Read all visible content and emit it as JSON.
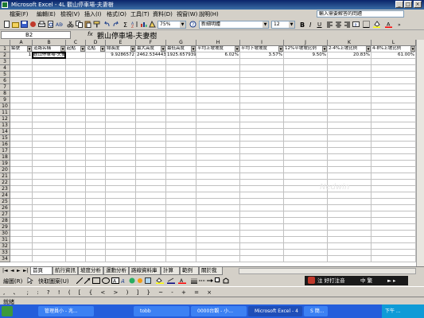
{
  "window": {
    "title": "Microsoft Excel - 4L 觀山停車場-夫妻樹"
  },
  "menu": {
    "items": [
      "檔案(F)",
      "編輯(E)",
      "檢視(V)",
      "插入(I)",
      "格式(O)",
      "工具(T)",
      "資料(D)",
      "視窗(W)",
      "說明(H)"
    ],
    "help_placeholder": "輸入需要解答的問題"
  },
  "toolbar": {
    "zoom": "75%",
    "font": "新細明體",
    "font_size": "12"
  },
  "formula_bar": {
    "name_box": "B2",
    "fx": "fx",
    "content": "觀山停車場-夫妻樹"
  },
  "grid": {
    "columns": [
      "A",
      "B",
      "C",
      "D",
      "E",
      "F",
      "G",
      "H",
      "I",
      "J",
      "K",
      "L"
    ],
    "headers": [
      "編號",
      "道路名稱",
      "起點",
      "迄點",
      "總長度",
      "最大高度",
      "最低高度",
      "平均上坡坡度",
      "平均下坡坡度",
      "12%平坡坡比例",
      "2-4%上坡比例",
      "4-8%上坡比例"
    ],
    "row2": [
      "1",
      "觀山停車場-夫妻樹",
      "",
      "",
      "9.9286572",
      "2462.534443",
      "1925.657939",
      "6.02%",
      "3.57%",
      "9.50%",
      "20.83%",
      "61.00%"
    ],
    "row_numbers": [
      "1",
      "2",
      "3",
      "4",
      "5",
      "6",
      "7",
      "8",
      "9",
      "10",
      "11",
      "12",
      "13",
      "14",
      "15",
      "16",
      "17",
      "18",
      "19",
      "20",
      "21",
      "22",
      "23",
      "24",
      "25",
      "26",
      "27",
      "28",
      "29",
      "30",
      "31",
      "32",
      "33",
      "34"
    ]
  },
  "sheet_tabs": [
    "首頁",
    "航行資訊",
    "坡度分析",
    "運動分析",
    "路線資料庫",
    "計算",
    "範例",
    "關於我"
  ],
  "drawing_toolbar": {
    "draw_label": "繪圖(R)",
    "autoshape_label": "快取圖案(U)"
  },
  "ime": {
    "text": "注 好打注音",
    "mode": "中 繁"
  },
  "status": {
    "text": "就緒"
  },
  "taskbar": {
    "items": [
      "管理員小 - 兆...",
      "tobb",
      "0000台觀 - 小...",
      "Microsoft Excel - 4",
      "S 簡..."
    ],
    "clock": "下午 ..."
  },
  "watermark": "Nedwin"
}
